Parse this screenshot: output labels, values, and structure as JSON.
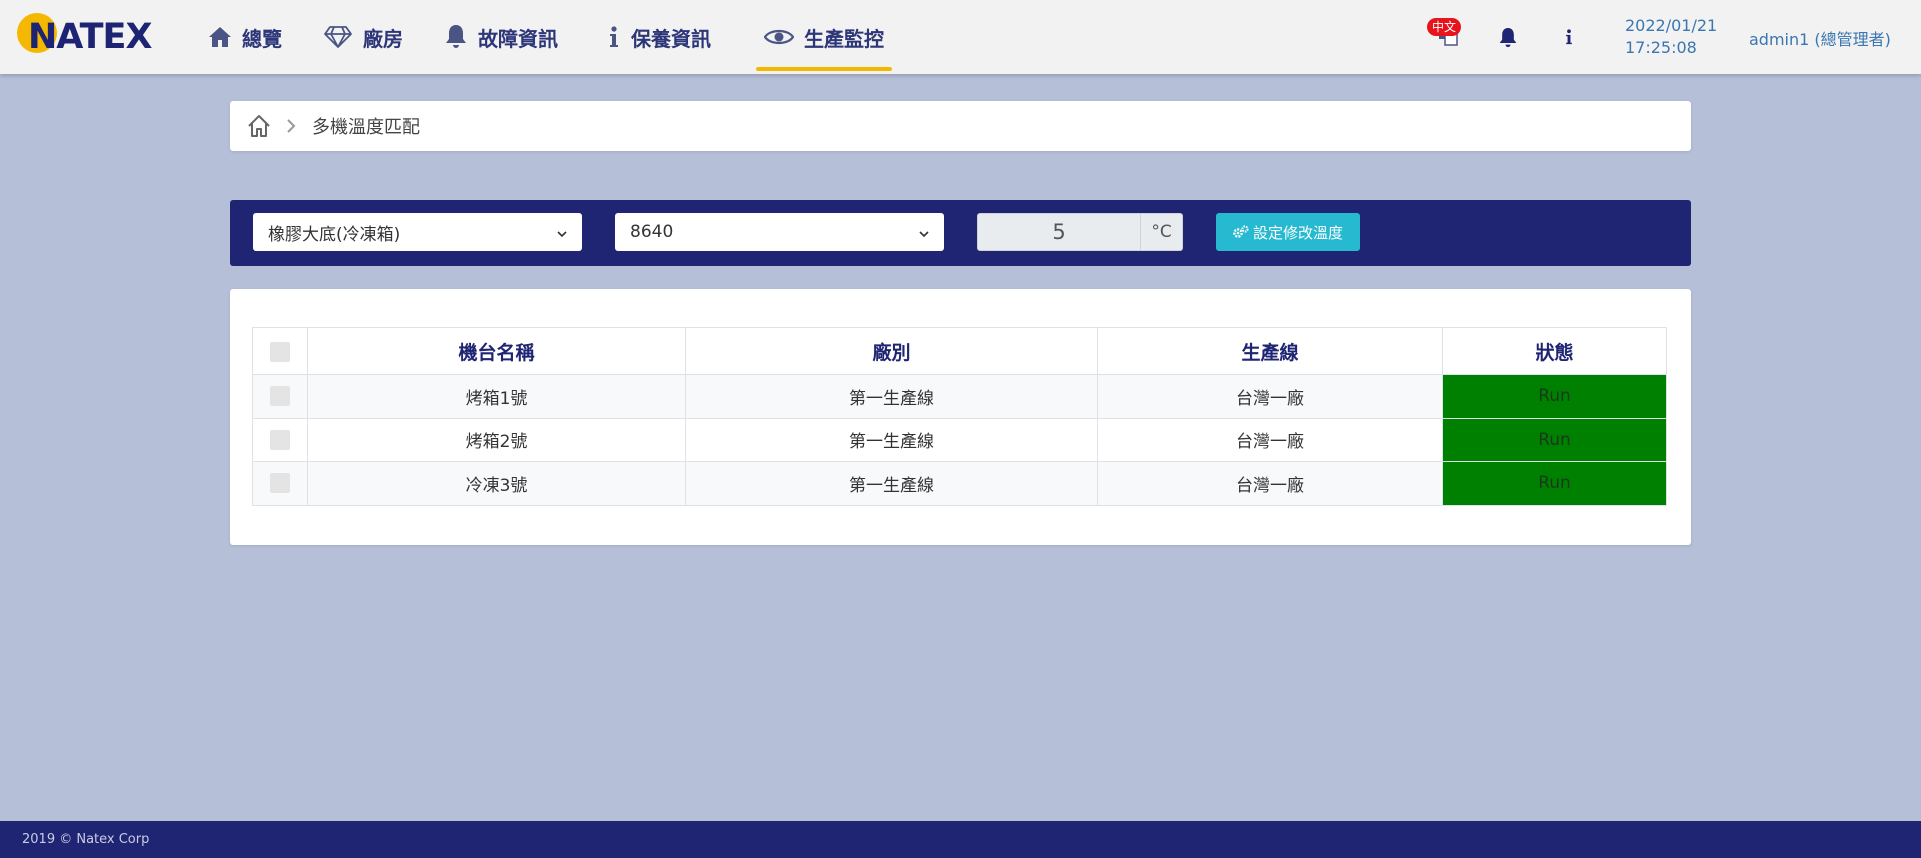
{
  "header": {
    "logo_text": "NATEX",
    "nav": [
      {
        "label": "總覽",
        "icon": "home-icon"
      },
      {
        "label": "廠房",
        "icon": "diamond-icon"
      },
      {
        "label": "故障資訊",
        "icon": "bell-icon"
      },
      {
        "label": "保養資訊",
        "icon": "info-icon"
      },
      {
        "label": "生產監控",
        "icon": "eye-icon",
        "active": true
      }
    ],
    "lang_badge": "中文",
    "date": "2022/01/21",
    "time": "17:25:08",
    "user": "admin1 (總管理者)"
  },
  "breadcrumb": {
    "current": "多機溫度匹配"
  },
  "controls": {
    "product_select": "橡膠大底(冷凍箱)",
    "code_select": "8640",
    "temperature": "5",
    "unit": "°C",
    "set_button": "設定修改溫度"
  },
  "table": {
    "headers": [
      "機台名稱",
      "廠別",
      "生產線",
      "狀態"
    ],
    "rows": [
      {
        "name": "烤箱1號",
        "factory": "第一生產線",
        "line": "台灣一廠",
        "status": "Run"
      },
      {
        "name": "烤箱2號",
        "factory": "第一生產線",
        "line": "台灣一廠",
        "status": "Run"
      },
      {
        "name": "冷凍3號",
        "factory": "第一生產線",
        "line": "台灣一廠",
        "status": "Run"
      }
    ]
  },
  "colors": {
    "brand_navy": "#1f2473",
    "brand_yellow": "#f5b800",
    "status_run": "#008000",
    "button_cyan": "#26b9cf"
  },
  "footer": {
    "copyright": "2019 © Natex Corp"
  }
}
